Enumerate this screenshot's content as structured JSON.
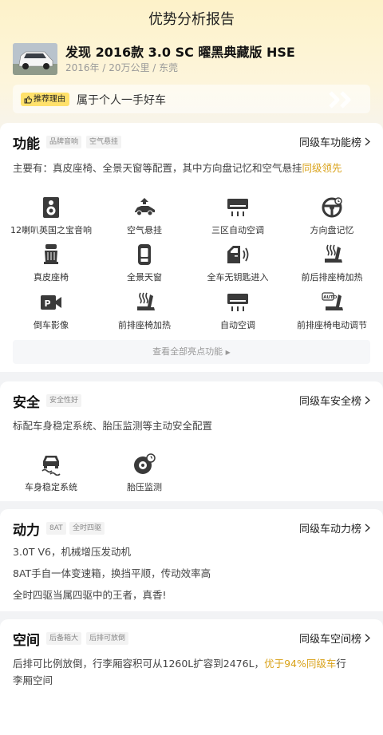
{
  "header": {
    "title": "优势分析报告",
    "car_name": "发现 2016款 3.0 SC 曜黑典藏版 HSE",
    "car_meta": "2016年 / 20万公里 / 东莞",
    "reason_tag": "推荐理由",
    "reason_text": "属于个人一手好车"
  },
  "function": {
    "title": "功能",
    "chips": [
      "品牌音响",
      "空气悬挂"
    ],
    "rank_label": "同级车功能榜",
    "desc_prefix": "主要有：真皮座椅、全景天窗等配置，其中方向盘记忆和空气悬挂",
    "desc_highlight": "同级领先",
    "features": [
      {
        "label": "12喇叭英国之宝音响",
        "icon": "speaker-icon"
      },
      {
        "label": "空气悬挂",
        "icon": "air-suspension-icon"
      },
      {
        "label": "三区自动空调",
        "icon": "tri-zone-ac-icon"
      },
      {
        "label": "方向盘记忆",
        "icon": "steering-wheel-icon"
      },
      {
        "label": "真皮座椅",
        "icon": "leather-seat-icon"
      },
      {
        "label": "全景天窗",
        "icon": "sunroof-icon"
      },
      {
        "label": "全车无钥匙进入",
        "icon": "keyless-entry-icon"
      },
      {
        "label": "前后排座椅加热",
        "icon": "seat-heating-icon"
      },
      {
        "label": "倒车影像",
        "icon": "reverse-camera-icon"
      },
      {
        "label": "前排座椅加热",
        "icon": "front-seat-heating-icon"
      },
      {
        "label": "自动空调",
        "icon": "auto-ac-icon"
      },
      {
        "label": "前排座椅电动调节",
        "icon": "power-seat-icon"
      }
    ],
    "more_label": "查看全部亮点功能"
  },
  "safety": {
    "title": "安全",
    "chips": [
      "安全性好"
    ],
    "rank_label": "同级车安全榜",
    "desc": "标配车身稳定系统、胎压监测等主动安全配置",
    "features": [
      {
        "label": "车身稳定系统",
        "icon": "stability-control-icon"
      },
      {
        "label": "胎压监测",
        "icon": "tire-pressure-icon"
      }
    ]
  },
  "power": {
    "title": "动力",
    "chips": [
      "8AT",
      "全时四驱"
    ],
    "rank_label": "同级车动力榜",
    "lines": [
      "3.0T V6，机械增压发动机",
      "8AT手自一体变速箱，换挡平顺，传动效率高",
      "全时四驱当属四驱中的王者，真香!"
    ]
  },
  "space": {
    "title": "空间",
    "chips": [
      "后备箱大",
      "后排可放倒"
    ],
    "rank_label": "同级车空间榜",
    "desc_prefix": "后排可比例放倒，行李厢容积可从1260L扩容到2476L，",
    "desc_highlight": "优于94%同级车",
    "desc_suffix_1": "行",
    "desc_suffix_2": "李厢空间"
  },
  "colors": {
    "accent": "#d9a21a",
    "tag_bg": "#ffe16b",
    "header_bg": "#fdf2c9"
  }
}
